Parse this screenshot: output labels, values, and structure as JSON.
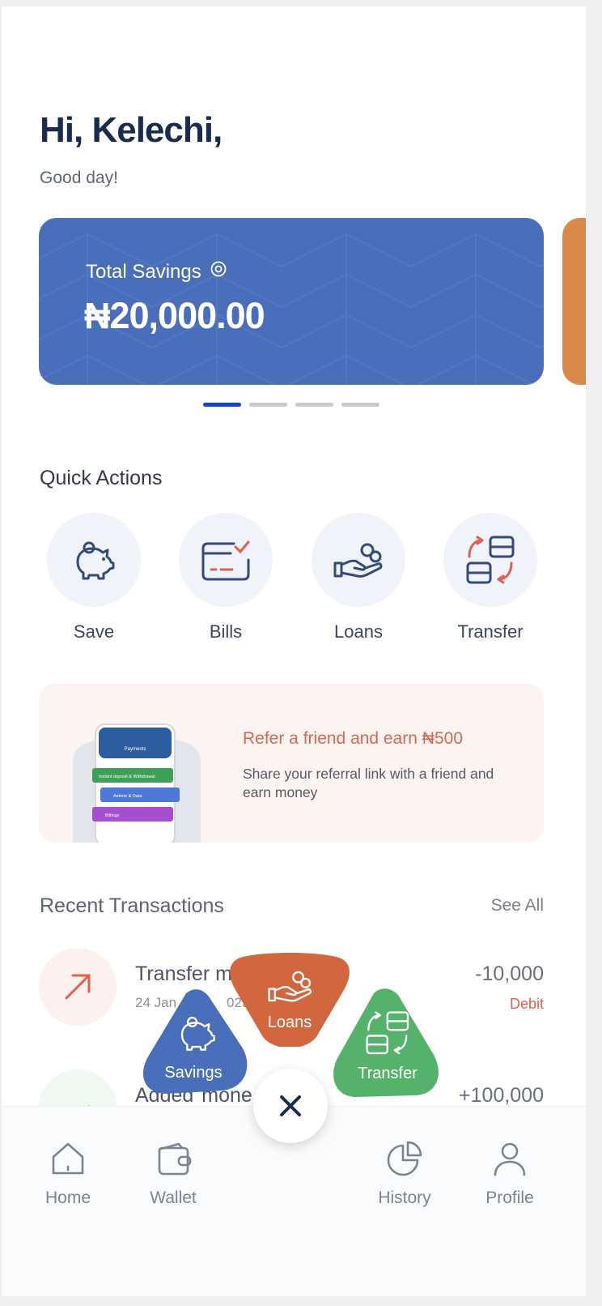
{
  "header": {
    "greeting": "Hi, Kelechi,",
    "subtitle": "Good day!"
  },
  "savings_card": {
    "label": "Total Savings",
    "amount": "₦20,000.00",
    "visibility_icon": "eye-icon",
    "color": "#4a6fba",
    "next_card_color": "#d98a4a",
    "pagination": {
      "count": 4,
      "active_index": 0
    }
  },
  "quick_actions": {
    "title": "Quick Actions",
    "items": [
      {
        "label": "Save",
        "icon": "piggy-bank-icon"
      },
      {
        "label": "Bills",
        "icon": "bill-icon"
      },
      {
        "label": "Loans",
        "icon": "hand-coins-icon"
      },
      {
        "label": "Transfer",
        "icon": "transfer-icon"
      }
    ]
  },
  "referral": {
    "title": "Refer a friend and earn ₦500",
    "description": "Share your referral link with a friend and earn money",
    "mockup": {
      "header": "Payments",
      "items": [
        "Instant deposit & Withdrawal",
        "Airtime & Data",
        "Billings"
      ]
    }
  },
  "recent_transactions": {
    "title": "Recent Transactions",
    "see_all": "See All",
    "items": [
      {
        "name": "Transfer m",
        "date": "24 Jan",
        "date_tail": "023",
        "amount": "-10,000",
        "type": "Debit",
        "icon": "arrow-up-right-icon",
        "type_color": "#e0604e"
      },
      {
        "name": "Added",
        "name_tail": "mone",
        "amount": "+100,000",
        "icon": "check-icon"
      }
    ]
  },
  "fab_menu": {
    "items": [
      {
        "label": "Savings",
        "icon": "piggy-bank-icon",
        "color": "#4a6fba"
      },
      {
        "label": "Loans",
        "icon": "hand-coins-icon",
        "color": "#d2673f"
      },
      {
        "label": "Transfer",
        "icon": "transfer-icon",
        "color": "#55b26a"
      }
    ],
    "close_icon": "close-icon"
  },
  "bottom_nav": {
    "items": [
      {
        "label": "Home",
        "icon": "home-icon"
      },
      {
        "label": "Wallet",
        "icon": "wallet-icon"
      },
      {
        "label": "History",
        "icon": "pie-chart-icon"
      },
      {
        "label": "Profile",
        "icon": "user-icon"
      }
    ]
  }
}
